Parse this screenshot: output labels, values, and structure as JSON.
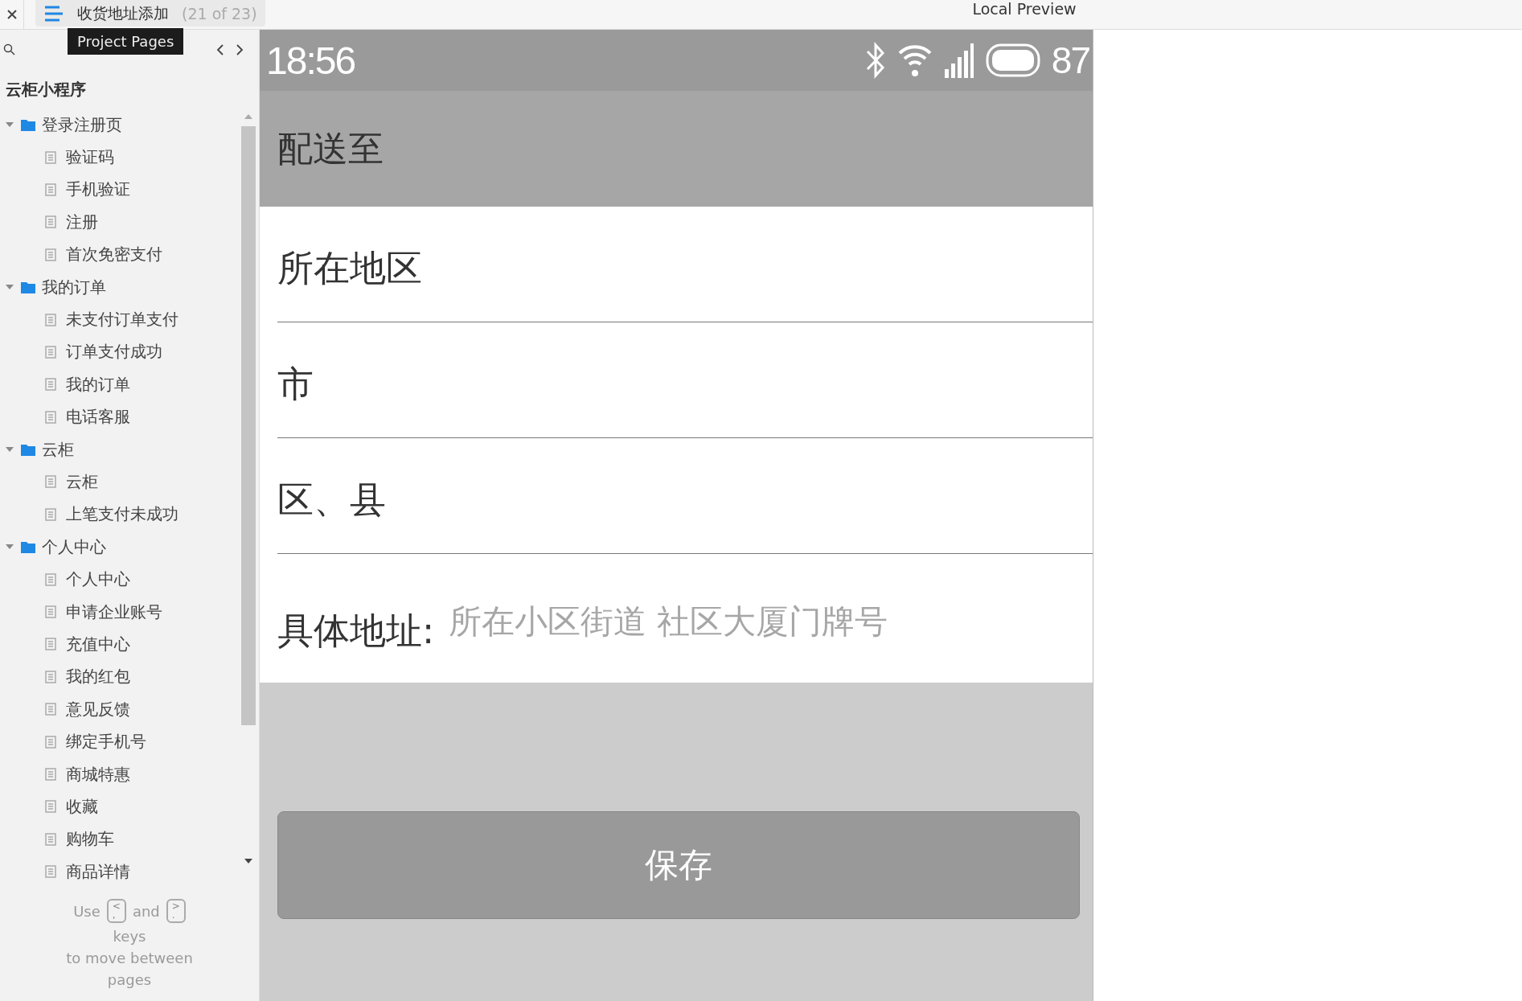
{
  "window": {
    "tab": {
      "title": "收货地址添加",
      "counter": "(21 of 23)"
    },
    "title": "Local Preview"
  },
  "sidebar": {
    "tooltip": "Project Pages",
    "project": "云柜小程序",
    "tree": [
      {
        "label": "登录注册页",
        "expanded": true,
        "children": [
          {
            "label": "验证码"
          },
          {
            "label": "手机验证"
          },
          {
            "label": "注册"
          },
          {
            "label": "首次免密支付"
          }
        ]
      },
      {
        "label": "我的订单",
        "expanded": true,
        "children": [
          {
            "label": "未支付订单支付"
          },
          {
            "label": "订单支付成功"
          },
          {
            "label": "我的订单"
          },
          {
            "label": "电话客服"
          }
        ]
      },
      {
        "label": "云柜",
        "expanded": true,
        "children": [
          {
            "label": "云柜"
          },
          {
            "label": "上笔支付未成功"
          }
        ]
      },
      {
        "label": "个人中心",
        "expanded": true,
        "children": [
          {
            "label": "个人中心"
          },
          {
            "label": "申请企业账号"
          },
          {
            "label": "充值中心"
          },
          {
            "label": "我的红包"
          },
          {
            "label": "意见反馈"
          },
          {
            "label": "绑定手机号"
          },
          {
            "label": "商城特惠"
          },
          {
            "label": "收藏"
          },
          {
            "label": "购物车"
          },
          {
            "label": "商品详情"
          }
        ]
      }
    ],
    "hint": {
      "use": "Use",
      "key_prev": {
        "top": "<",
        "bottom": ","
      },
      "and": "and",
      "key_next": {
        "top": ">",
        "bottom": "."
      },
      "lines": [
        "keys",
        "to move between",
        "pages"
      ]
    }
  },
  "phone": {
    "status_bar": {
      "time": "18:56",
      "battery": "87"
    },
    "header": "配送至",
    "form": [
      {
        "kind": "label",
        "label": "所在地区"
      },
      {
        "kind": "label",
        "label": "市"
      },
      {
        "kind": "label",
        "label": "区、县"
      },
      {
        "kind": "input",
        "label": "具体地址:",
        "placeholder": "所在小区街道 社区大厦门牌号"
      }
    ],
    "save_button": "保存"
  }
}
